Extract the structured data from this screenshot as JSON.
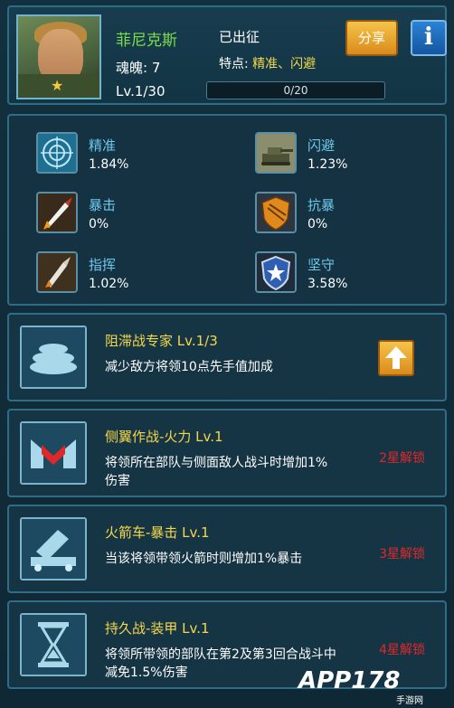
{
  "header": {
    "name": "菲尼克斯",
    "soul_label": "魂魄: 7",
    "level": "Lv.1/30",
    "status": "已出征",
    "trait_prefix": "特点: ",
    "trait_value": "精准、闪避",
    "progress_text": "0/20",
    "progress_fraction": 0,
    "share_label": "分享",
    "info_label": "i"
  },
  "stats": [
    {
      "label": "精准",
      "value": "1.84%",
      "icon": "target-icon"
    },
    {
      "label": "闪避",
      "value": "1.23%",
      "icon": "tank-icon"
    },
    {
      "label": "暴击",
      "value": "0%",
      "icon": "missile-icon"
    },
    {
      "label": "抗暴",
      "value": "0%",
      "icon": "shield-icon"
    },
    {
      "label": "指挥",
      "value": "1.02%",
      "icon": "rocket-icon"
    },
    {
      "label": "坚守",
      "value": "3.58%",
      "icon": "star-shield-icon"
    }
  ],
  "skills": [
    {
      "title": "阻滞战专家 Lv.1/3",
      "desc": "减少敌方将领10点先手值加成",
      "unlock": "",
      "icon": "sandbag-icon"
    },
    {
      "title": "侧翼作战-火力 Lv.1",
      "desc": "将领所在部队与侧面敌人战斗时增加1%伤害",
      "unlock": "2星解锁",
      "icon": "flank-icon"
    },
    {
      "title": "火箭车-暴击 Lv.1",
      "desc": "当该将领带领火箭时则增加1%暴击",
      "unlock": "3星解锁",
      "icon": "rocket-truck-icon"
    },
    {
      "title": "持久战-装甲 Lv.1",
      "desc": "将领所带领的部队在第2及第3回合战斗中减免1.5%伤害",
      "unlock": "4星解锁",
      "icon": "hourglass-icon"
    }
  ],
  "watermark": {
    "text": "APP178",
    "sub": "手游网"
  },
  "colors": {
    "accent_green": "#7ddc4b",
    "gold": "#f5d74b",
    "cyan": "#6ec8ea",
    "red": "#e0282a"
  }
}
